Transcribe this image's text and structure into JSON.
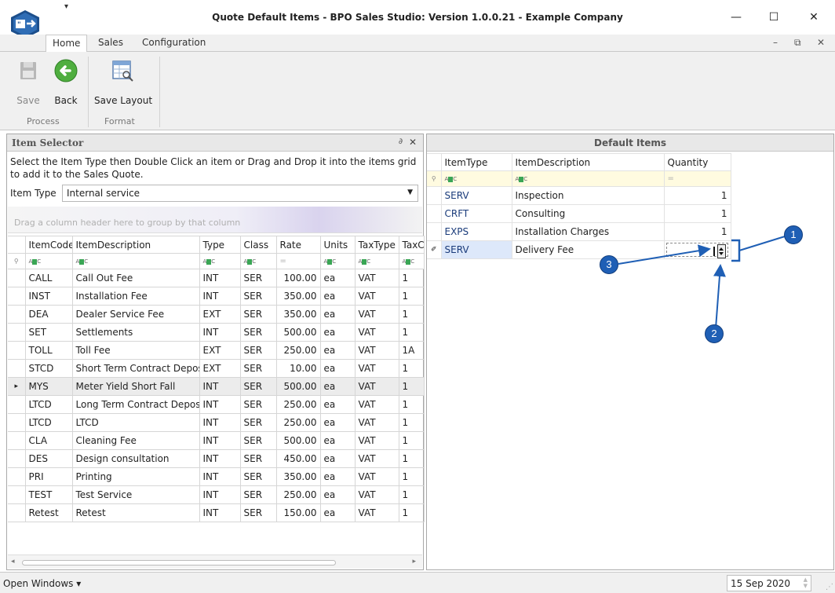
{
  "window": {
    "title": "Quote Default Items - BPO Sales Studio: Version 1.0.0.21 - Example Company",
    "qat_symbol": "▾",
    "minimize": "—",
    "maximize": "☐",
    "close": "✕"
  },
  "ribbon": {
    "tabs": [
      "Home",
      "Sales",
      "Configuration"
    ],
    "active_tab": "Home",
    "mdi_min": "–",
    "mdi_restore": "⧉",
    "mdi_close": "✕",
    "buttons": {
      "save": "Save",
      "back": "Back",
      "save_layout": "Save Layout"
    },
    "groups": {
      "process": "Process",
      "format": "Format"
    }
  },
  "item_selector": {
    "title": "Item Selector",
    "pin": "∂",
    "close": "✕",
    "instructions": "Select the Item Type then Double Click an item or Drag and Drop it into the items grid to add it to the Sales Quote.",
    "item_type_label": "Item Type",
    "item_type_value": "Internal service",
    "group_hint": "Drag a column header here to group by that column",
    "columns": [
      "ItemCode",
      "ItemDescription",
      "Type",
      "Class",
      "Rate",
      "Units",
      "TaxType",
      "TaxC"
    ],
    "rows": [
      {
        "code": "CALL",
        "desc": "Call Out Fee",
        "type": "INT",
        "class": "SER",
        "rate": "100.00",
        "units": "ea",
        "taxtype": "VAT",
        "taxc": "1"
      },
      {
        "code": "INST",
        "desc": "Installation Fee",
        "type": "INT",
        "class": "SER",
        "rate": "350.00",
        "units": "ea",
        "taxtype": "VAT",
        "taxc": "1"
      },
      {
        "code": "DEA",
        "desc": "Dealer Service Fee",
        "type": "EXT",
        "class": "SER",
        "rate": "350.00",
        "units": "ea",
        "taxtype": "VAT",
        "taxc": "1"
      },
      {
        "code": "SET",
        "desc": "Settlements",
        "type": "INT",
        "class": "SER",
        "rate": "500.00",
        "units": "ea",
        "taxtype": "VAT",
        "taxc": "1"
      },
      {
        "code": "TOLL",
        "desc": "Toll Fee",
        "type": "EXT",
        "class": "SER",
        "rate": "250.00",
        "units": "ea",
        "taxtype": "VAT",
        "taxc": "1A"
      },
      {
        "code": "STCD",
        "desc": "Short Term Contract Deposit",
        "type": "EXT",
        "class": "SER",
        "rate": "10.00",
        "units": "ea",
        "taxtype": "VAT",
        "taxc": "1"
      },
      {
        "code": "MYS",
        "desc": "Meter Yield Short Fall",
        "type": "INT",
        "class": "SER",
        "rate": "500.00",
        "units": "ea",
        "taxtype": "VAT",
        "taxc": "1"
      },
      {
        "code": "LTCD",
        "desc": "Long Term Contract Deposit",
        "type": "INT",
        "class": "SER",
        "rate": "250.00",
        "units": "ea",
        "taxtype": "VAT",
        "taxc": "1"
      },
      {
        "code": "LTCD",
        "desc": "LTCD",
        "type": "INT",
        "class": "SER",
        "rate": "250.00",
        "units": "ea",
        "taxtype": "VAT",
        "taxc": "1"
      },
      {
        "code": "CLA",
        "desc": "Cleaning Fee",
        "type": "INT",
        "class": "SER",
        "rate": "500.00",
        "units": "ea",
        "taxtype": "VAT",
        "taxc": "1"
      },
      {
        "code": "DES",
        "desc": "Design consultation",
        "type": "INT",
        "class": "SER",
        "rate": "450.00",
        "units": "ea",
        "taxtype": "VAT",
        "taxc": "1"
      },
      {
        "code": "PRI",
        "desc": "Printing",
        "type": "INT",
        "class": "SER",
        "rate": "350.00",
        "units": "ea",
        "taxtype": "VAT",
        "taxc": "1"
      },
      {
        "code": "TEST",
        "desc": "Test Service",
        "type": "INT",
        "class": "SER",
        "rate": "250.00",
        "units": "ea",
        "taxtype": "VAT",
        "taxc": "1"
      },
      {
        "code": "Retest",
        "desc": "Retest",
        "type": "INT",
        "class": "SER",
        "rate": "150.00",
        "units": "ea",
        "taxtype": "VAT",
        "taxc": "1"
      }
    ],
    "selected_row_marker": "▸"
  },
  "default_items": {
    "title": "Default Items",
    "columns": [
      "ItemType",
      "ItemDescription",
      "Quantity"
    ],
    "rows": [
      {
        "type": "SERV",
        "desc": "Inspection",
        "qty": "1"
      },
      {
        "type": "CRFT",
        "desc": "Consulting",
        "qty": "1"
      },
      {
        "type": "EXPS",
        "desc": "Installation Charges",
        "qty": "1"
      },
      {
        "type": "SERV",
        "desc": "Delivery Fee",
        "qty": ""
      }
    ],
    "edit_marker": "✐"
  },
  "statusbar": {
    "open_windows": "Open Windows ▾",
    "date": "15 Sep 2020"
  },
  "annotations": {
    "badges": [
      "1",
      "2",
      "3"
    ],
    "color": "#1f5fb5"
  },
  "icons": [
    "app-logo-icon",
    "save-disk-icon",
    "back-arrow-icon",
    "save-layout-icon",
    "pin-icon",
    "filter-icon"
  ]
}
